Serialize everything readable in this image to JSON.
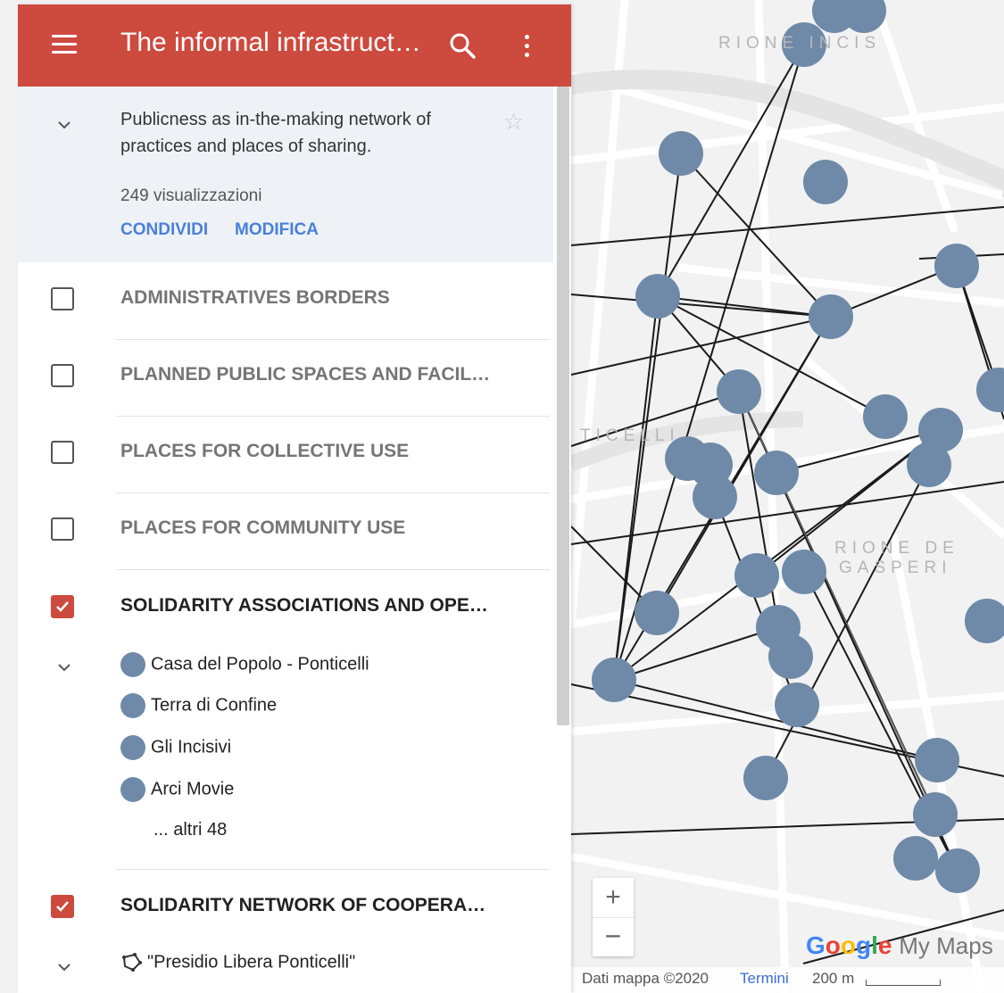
{
  "header": {
    "title": "The informal infrastruct…",
    "bg_color": "#cd4a3e"
  },
  "description": {
    "text": "Publicness as in-the-making network of practices and places of sharing.",
    "views": "249 visualizzazioni",
    "share_label": "CONDIVIDI",
    "edit_label": "MODIFICA"
  },
  "layers": [
    {
      "name": "ADMINISTRATIVES BORDERS",
      "checked": false
    },
    {
      "name": "PLANNED PUBLIC SPACES AND FACIL…",
      "checked": false
    },
    {
      "name": "PLACES FOR COLLECTIVE USE",
      "checked": false
    },
    {
      "name": "PLACES FOR COMMUNITY USE",
      "checked": false
    },
    {
      "name": "SOLIDARITY ASSOCIATIONS AND OPE…",
      "checked": true,
      "items": [
        "Casa del Popolo - Ponticelli",
        "Terra di Confine",
        "Gli Incisivi",
        "Arci Movie"
      ],
      "more": "... altri 48",
      "marker_color": "#6e8aa8"
    },
    {
      "name": "SOLIDARITY NETWORK OF COOPERA…",
      "checked": true,
      "items": [
        "\"Presidio Libera Ponticelli\""
      ],
      "icon": "polyline-icon"
    }
  ],
  "map": {
    "district_labels": [
      "RIONE INCIS",
      "RIONE DE",
      "GASPERI",
      "TICELLI"
    ],
    "zoom_in": "+",
    "zoom_out": "−",
    "logo": {
      "google": "Google",
      "my_maps": "My Maps"
    },
    "footer": {
      "data": "Dati mappa ©2020",
      "terms": "Termini",
      "scale": "200 m"
    }
  },
  "colors": {
    "accent_blue": "#4a80d9",
    "marker": "#6e8aa8",
    "checkbox_on": "#cd4a3e"
  }
}
